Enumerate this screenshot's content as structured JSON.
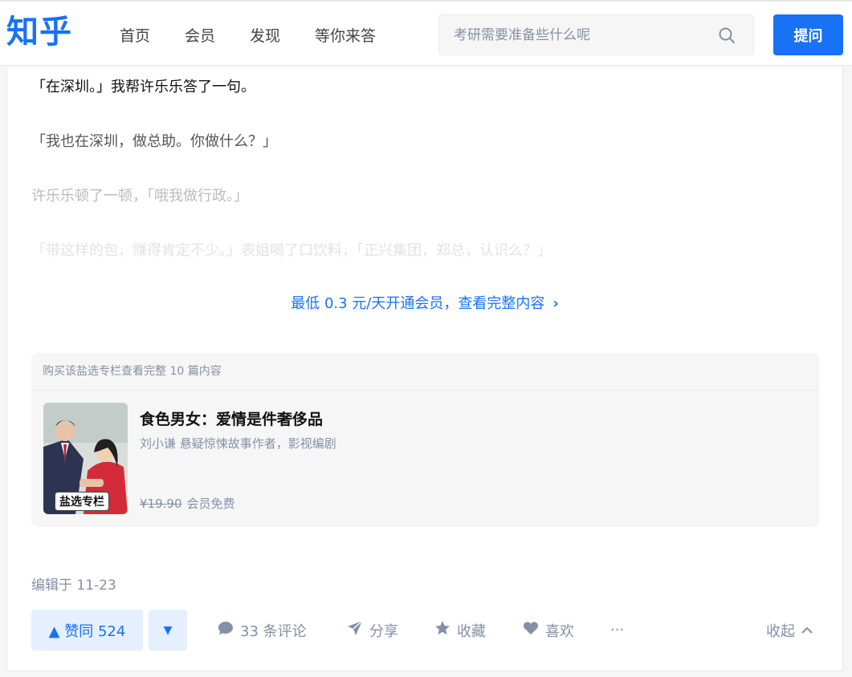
{
  "header": {
    "logo": "知乎",
    "nav": [
      "首页",
      "会员",
      "发现",
      "等你来答"
    ],
    "search_placeholder": "考研需要准备些什么呢",
    "ask_label": "提问"
  },
  "content": {
    "paragraphs": [
      "「在深圳。」我帮许乐乐答了一句。",
      "「我也在深圳，做总助。你做什么？」",
      "许乐乐顿了一顿，「哦我做行政。」",
      "「带这样的包，赚得肯定不少。」表姐喝了口饮料，「正兴集团，郑总，认识么？」"
    ],
    "unlock_text": "最低 0.3 元/天开通会员，查看完整内容"
  },
  "column": {
    "header": "购买该盐选专栏查看完整 10 篇内容",
    "title": "食色男女：爱情是件奢侈品",
    "author": "刘小谦 悬疑惊悚故事作者，影视编剧",
    "badge": "盐选专栏",
    "price_old": "¥19.90",
    "price_member": "会员免费"
  },
  "meta": {
    "edited": "编辑于 11-23"
  },
  "actions": {
    "upvote": "▲ 赞同 524",
    "downvote": "▼",
    "comments": "33 条评论",
    "share": "分享",
    "favorite": "收藏",
    "like": "喜欢",
    "more": "···",
    "collapse": "收起"
  },
  "colors": {
    "brand": "#1772f6",
    "muted": "#8590a6"
  }
}
